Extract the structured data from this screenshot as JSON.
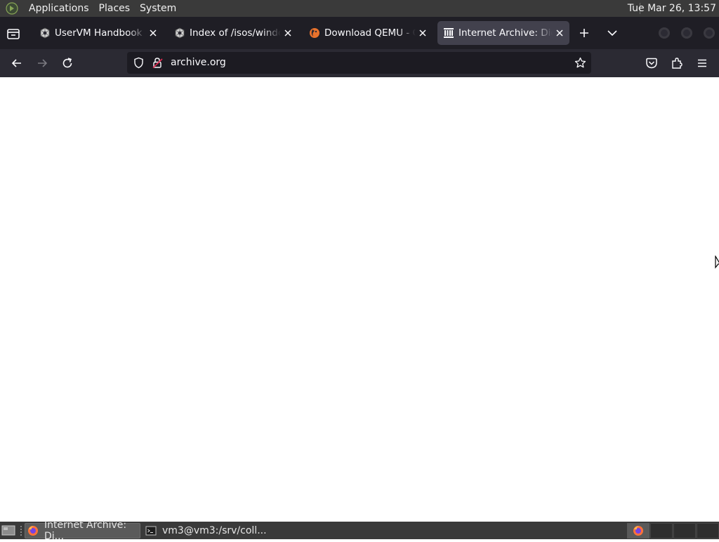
{
  "top_panel": {
    "menus": [
      "Applications",
      "Places",
      "System"
    ],
    "clock": "Tue Mar 26, 13:57"
  },
  "tabs": [
    {
      "title": "UserVM Handbook - Ca",
      "favicon": "uservm-icon",
      "active": false
    },
    {
      "title": "Index of /isos/windows",
      "favicon": "uservm-icon",
      "active": false
    },
    {
      "title": "Download QEMU - QEMU",
      "favicon": "qemu-icon",
      "active": false
    },
    {
      "title": "Internet Archive: Digital",
      "favicon": "archive-icon",
      "active": true
    }
  ],
  "urlbar": {
    "url": "archive.org"
  },
  "taskbar": {
    "tasks": [
      {
        "label": "Internet Archive: Di...",
        "icon": "firefox-icon",
        "active": true
      },
      {
        "label": "vm3@vm3:/srv/coll...",
        "icon": "terminal-icon",
        "active": false
      }
    ]
  },
  "colors": {
    "panel": "#3a3a3a",
    "tabbar": "#1f1e25",
    "navbar": "#2b2a33",
    "urlbar": "#1c1b22",
    "active_tab": "#42414d",
    "page": "#ffffff"
  }
}
